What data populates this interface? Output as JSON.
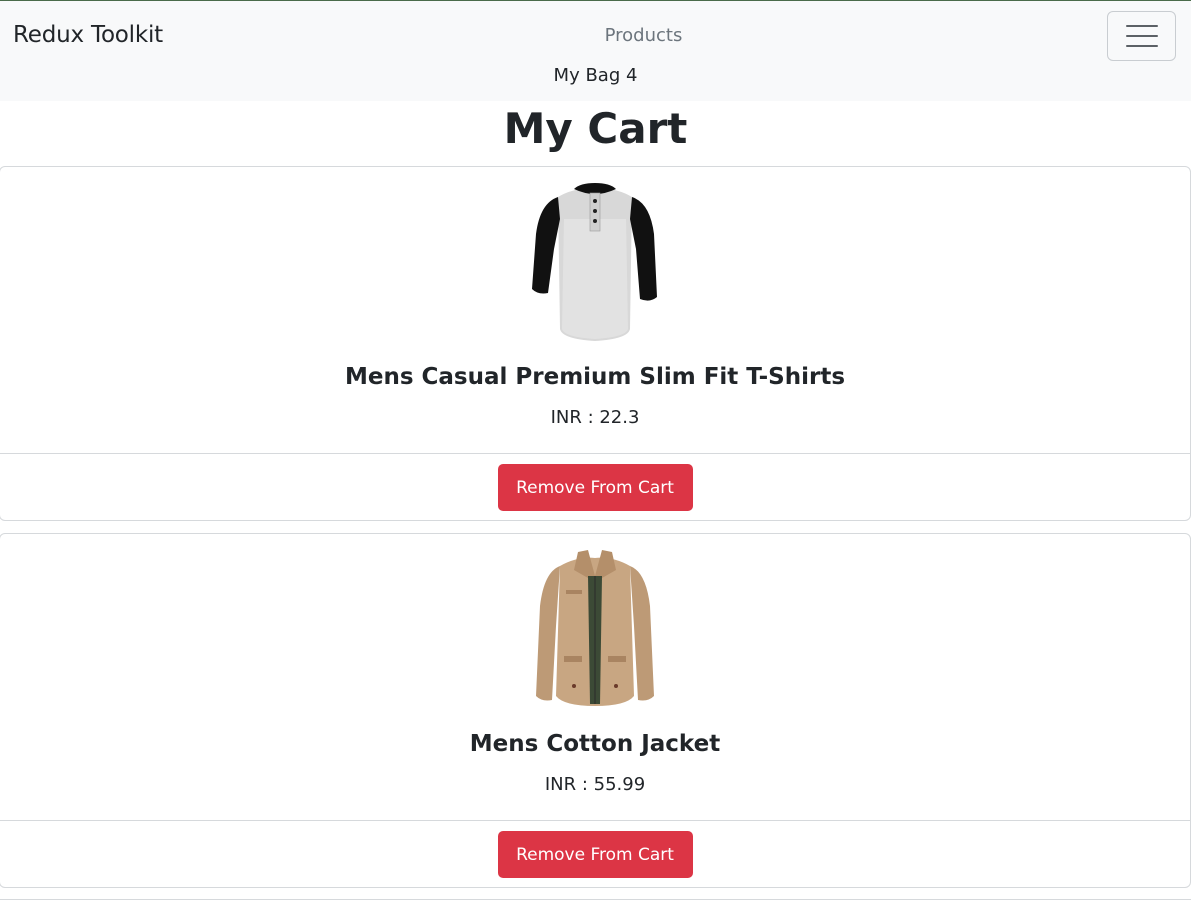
{
  "navbar": {
    "brand": "Redux Toolkit",
    "products_link": "Products",
    "bag_label": "My Bag 4",
    "toggler_icon": "hamburger-menu-icon"
  },
  "page": {
    "title": "My Cart"
  },
  "cart": {
    "items": [
      {
        "name": "Mens Casual Premium Slim Fit T-Shirts",
        "price_text": "INR : 22.3",
        "image_icon": "tshirt-image",
        "button_label": "Remove From Cart"
      },
      {
        "name": "Mens Cotton Jacket",
        "price_text": "INR : 55.99",
        "image_icon": "jacket-image",
        "button_label": "Remove From Cart"
      }
    ]
  },
  "colors": {
    "navbar_bg": "#f8f9fa",
    "danger": "#dc3545",
    "text": "#212529",
    "muted": "#6c757d"
  }
}
